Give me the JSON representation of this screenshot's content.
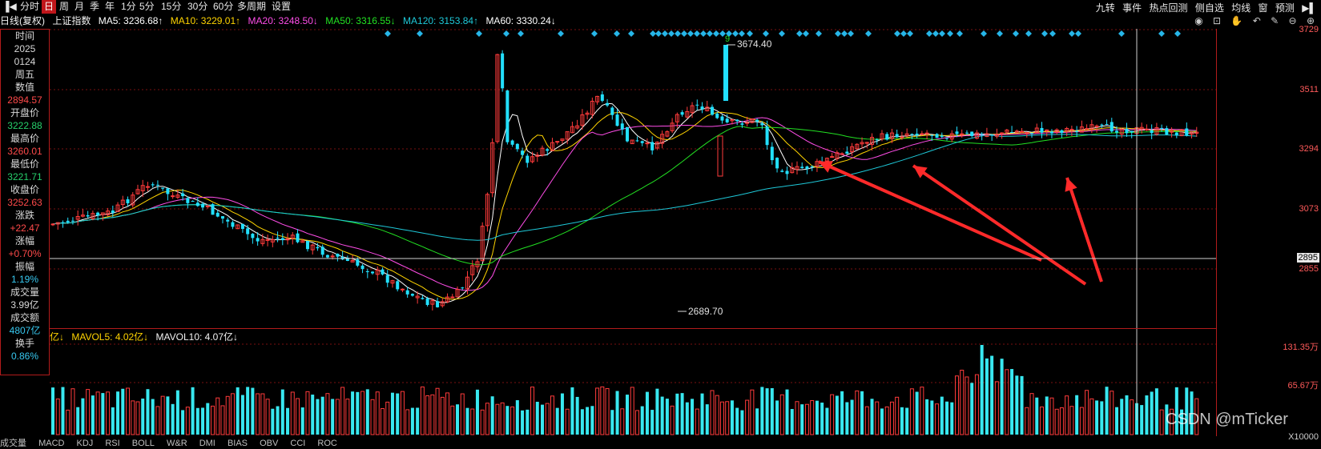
{
  "toolbar": {
    "items": [
      "分时",
      "日",
      "周",
      "月",
      "季",
      "年",
      "1分",
      "5分",
      "15分",
      "30分",
      "60分",
      "多周期",
      "设置"
    ],
    "active_index": 1,
    "right_items": [
      "九转",
      "事件",
      "热点回测",
      "侧自选",
      "均线",
      "窗",
      "预测"
    ]
  },
  "ma_bar": {
    "period_label": "日线(复权)",
    "index_name": "上证指数",
    "ma5": "MA5: 3236.68↑",
    "ma10": "MA10: 3229.01↑",
    "ma20": "MA20: 3248.50↓",
    "ma50": "MA50: 3316.55↓",
    "ma120": "MA120: 3153.84↑",
    "ma60": "MA60: 3330.24↓",
    "colors": {
      "ma5": "#ffffff",
      "ma10": "#ffd400",
      "ma20": "#ff4de8",
      "ma50": "#22e022",
      "ma120": "#1ec8d8",
      "ma60": "#ffffff"
    }
  },
  "info_panel": {
    "time_label": "时间",
    "year": "2025",
    "date": "0124",
    "weekday": "周五",
    "value_label": "数值",
    "value": "2894.57",
    "open_label": "开盘价",
    "open": "3222.88",
    "high_label": "最高价",
    "high": "3260.01",
    "low_label": "最低价",
    "low": "3221.71",
    "close_label": "收盘价",
    "close": "3252.63",
    "change_label": "涨跌",
    "change": "+22.47",
    "change_pct_label": "涨幅",
    "change_pct": "+0.70%",
    "amplitude_label": "振幅",
    "amplitude": "1.19%",
    "volume_label": "成交量",
    "volume": "3.99亿",
    "turnover_label": "成交额",
    "turnover": "4807亿",
    "turnover_rate_label": "换手",
    "turnover_rate": "0.86%"
  },
  "price_axis": {
    "ticks": [
      "3729",
      "3511",
      "3294",
      "3073",
      "2855"
    ],
    "cursor_value": "2895"
  },
  "annotations": {
    "high": "3674.40",
    "low": "2689.70"
  },
  "volume_bar": {
    "prefix": "亿↓",
    "mavol5": "MAVOL5: 4.02亿↓",
    "mavol10": "MAVOL10: 4.07亿↓",
    "axis_high": "131.35万",
    "axis_mid": "65.67万",
    "axis_unit": "X10000"
  },
  "watermark": "CSDN @mTicker",
  "bottom_tabs": [
    "成交量",
    "MACD",
    "KDJ",
    "RSI",
    "BOLL",
    "W&R",
    "DMI",
    "BIAS",
    "OBV",
    "CCI",
    "ROC"
  ]
}
